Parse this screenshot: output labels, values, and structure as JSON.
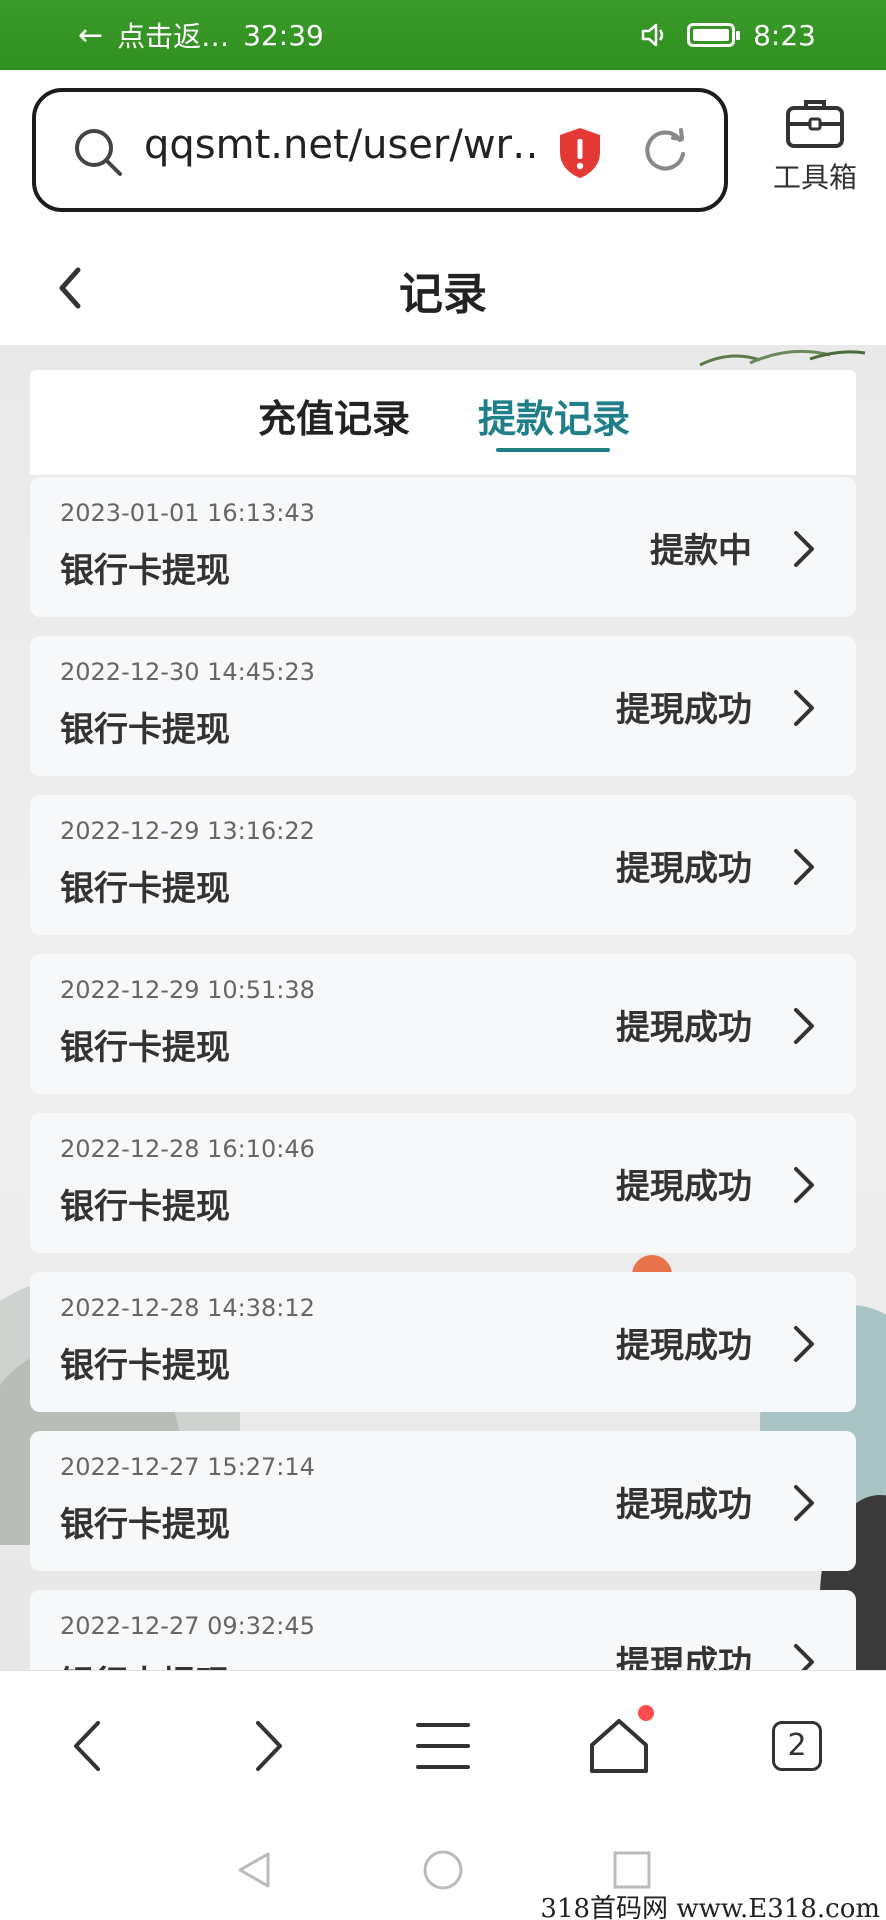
{
  "status_bar": {
    "left_text": "点击返…",
    "timer": "32:39",
    "clock": "8:23"
  },
  "browser": {
    "url": "qqsmt.net/user/wr…",
    "toolbox_label": "工具箱",
    "tab_count": "2"
  },
  "page": {
    "title": "记录"
  },
  "tabs": [
    {
      "label": "充值记录",
      "active": false
    },
    {
      "label": "提款记录",
      "active": true
    }
  ],
  "records": [
    {
      "time": "2023-01-01 16:13:43",
      "type": "银行卡提现",
      "status": "提款中"
    },
    {
      "time": "2022-12-30 14:45:23",
      "type": "银行卡提现",
      "status": "提現成功"
    },
    {
      "time": "2022-12-29 13:16:22",
      "type": "银行卡提现",
      "status": "提現成功"
    },
    {
      "time": "2022-12-29 10:51:38",
      "type": "银行卡提现",
      "status": "提現成功"
    },
    {
      "time": "2022-12-28 16:10:46",
      "type": "银行卡提现",
      "status": "提現成功"
    },
    {
      "time": "2022-12-28 14:38:12",
      "type": "银行卡提现",
      "status": "提現成功"
    },
    {
      "time": "2022-12-27 15:27:14",
      "type": "银行卡提现",
      "status": "提現成功"
    },
    {
      "time": "2022-12-27 09:32:45",
      "type": "银行卡提现",
      "status": "提現成功"
    }
  ],
  "watermark": "318首码网 www.E318.com",
  "colors": {
    "status_bar": "#2f8f1f",
    "active_tab": "#1e7f88",
    "shield": "#e53935",
    "notification_dot": "#ff4d4f"
  }
}
